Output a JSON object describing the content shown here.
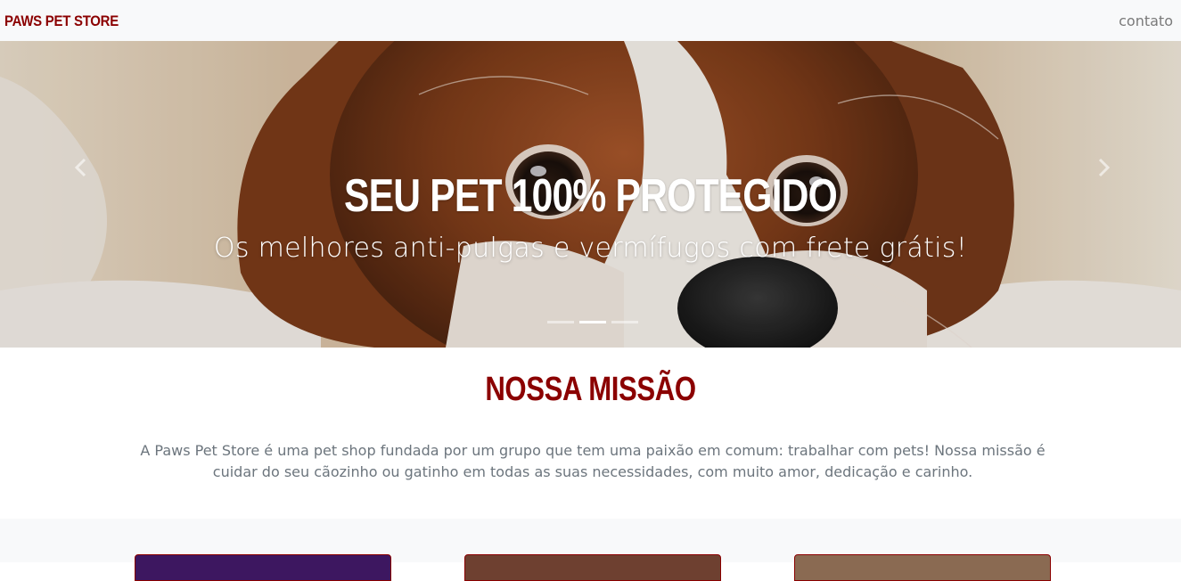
{
  "navbar": {
    "brand": "PAWS PET STORE",
    "contact_link": "contato"
  },
  "carousel": {
    "title": "SEU PET 100% PROTEGIDO",
    "subtitle": "Os melhores anti-pulgas e vermífugos com frete grátis!",
    "slide_count": 3,
    "active_slide": 2,
    "prev_icon": "chevron-left-icon",
    "next_icon": "chevron-right-icon"
  },
  "mission": {
    "title": "NOSSA MISSÃO",
    "text": "A Paws Pet Store é uma pet shop fundada por um grupo que tem uma paixão em comum: trabalhar com pets! Nossa missão é cuidar do seu cãozinho ou gatinho em todas as suas necessidades, com muito amor, dedicação e carinho."
  },
  "colors": {
    "brand": "#8b0000",
    "navbar_bg": "#f8f9fa",
    "text_muted": "#6c757d"
  }
}
